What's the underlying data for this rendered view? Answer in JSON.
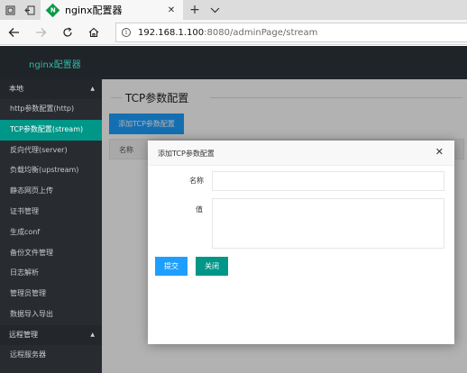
{
  "browser": {
    "tab_title": "nginx配置器",
    "favicon_letter": "N",
    "close_glyph": "✕",
    "new_tab_glyph": "+",
    "url_host": "192.168.1.100",
    "url_rest": ":8080/adminPage/stream"
  },
  "app": {
    "brand": "nginx配置器"
  },
  "sidebar": {
    "group_local": "本地",
    "items": [
      {
        "label": "http参数配置(http)"
      },
      {
        "label": "TCP参数配置(stream)"
      },
      {
        "label": "反向代理(server)"
      },
      {
        "label": "负载均衡(upstream)"
      },
      {
        "label": "静态网页上传"
      },
      {
        "label": "证书管理"
      },
      {
        "label": "生成conf"
      },
      {
        "label": "备份文件管理"
      },
      {
        "label": "日志解析"
      },
      {
        "label": "管理员管理"
      },
      {
        "label": "数据导入导出"
      }
    ],
    "active_index": 1,
    "group_remote": "远程管理",
    "remote_items": [
      {
        "label": "远程服务器"
      }
    ]
  },
  "main": {
    "title": "TCP参数配置",
    "add_button": "添加TCP参数配置",
    "table_header_name": "名称"
  },
  "dialog": {
    "title": "添加TCP参数配置",
    "close_glyph": "✕",
    "label_name": "名称",
    "label_value": "值",
    "name_value": "",
    "value_value": "",
    "submit_button": "提交",
    "close_button": "关闭"
  },
  "colors": {
    "accent_teal": "#009688",
    "accent_blue": "#1e9fff",
    "header_dark": "#1f2429",
    "sidebar_dark": "#282c31"
  }
}
